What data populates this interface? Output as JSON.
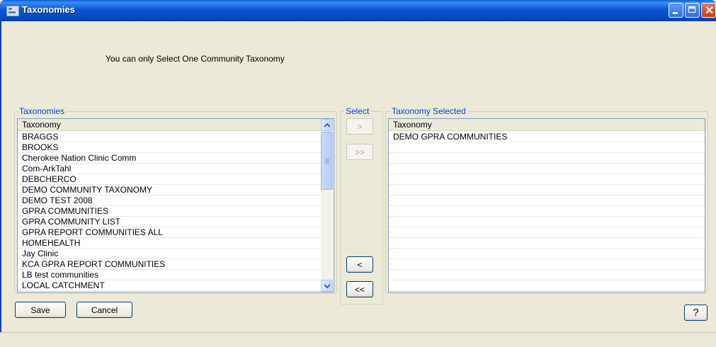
{
  "window": {
    "title": "Taxonomies"
  },
  "notice": "You can only Select One Community Taxonomy",
  "left_panel": {
    "group_label": "Taxonomies",
    "column_header": "Taxonomy",
    "items": [
      "BRAGGS",
      "BROOKS",
      "Cherokee Nation Clinic Comm",
      "Com-ArkTahl",
      "DEBCHERCO",
      "DEMO COMMUNITY TAXONOMY",
      "DEMO TEST 2008",
      "GPRA COMMUNITIES",
      "GPRA COMMUNITY LIST",
      "GPRA REPORT COMMUNITIES ALL",
      "HOMEHEALTH",
      "Jay Clinic",
      "KCA GPRA REPORT COMMUNITIES",
      "LB test communities",
      "LOCAL CATCHMENT"
    ]
  },
  "select_panel": {
    "group_label": "Select",
    "add_one": ">",
    "add_all": ">>",
    "remove_one": "<",
    "remove_all": "<<"
  },
  "right_panel": {
    "group_label": "Taxonomy Selected",
    "column_header": "Taxonomy",
    "items": [
      "DEMO GPRA COMMUNITIES"
    ]
  },
  "footer": {
    "save": "Save",
    "cancel": "Cancel",
    "help": "?"
  },
  "colors": {
    "title_bar": "#0a5fd8",
    "group_label": "#0046d5",
    "face": "#ece9d8"
  }
}
